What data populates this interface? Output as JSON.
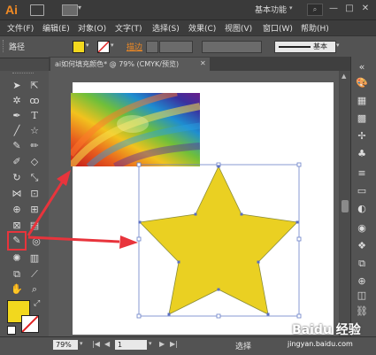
{
  "app": {
    "logo": "Ai",
    "workspace_label": "基本功能",
    "window_controls": [
      "—",
      "□",
      "✕"
    ]
  },
  "menu": [
    "文件(F)",
    "编辑(E)",
    "对象(O)",
    "文字(T)",
    "选择(S)",
    "效果(C)",
    "视图(V)",
    "窗口(W)",
    "帮助(H)"
  ],
  "control": {
    "selection_type": "路径",
    "fill_color": "#f2d81e",
    "stroke_label": "描边",
    "style_label": "基本"
  },
  "document": {
    "tab_title": "ai如何填充颜色* @ 79% (CMYK/预览)",
    "tab_close": "✕"
  },
  "tools": {
    "fill_color": "#f2d81e",
    "stroke_color": "none"
  },
  "artwork": {
    "star_color": "#ead022",
    "star_stroke": "#8a8c3a",
    "selection_color": "#6a7fc8",
    "arrow_color": "#e8343c"
  },
  "status": {
    "zoom": "79%",
    "page": "1",
    "mode": "选择"
  },
  "watermark": {
    "brand": "Baidu 经验",
    "url": "jingyan.baidu.com"
  }
}
